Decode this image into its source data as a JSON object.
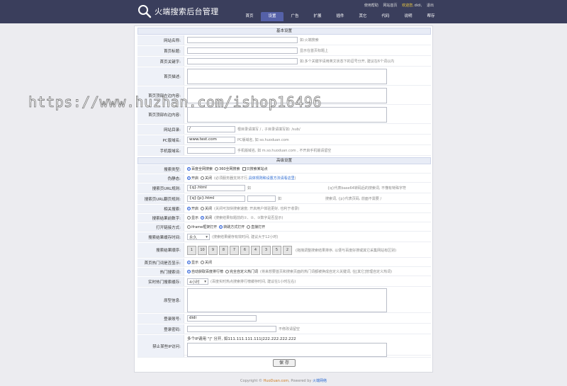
{
  "header": {
    "title": "火端搜索后台管理",
    "toplinks": {
      "help": "使用帮助",
      "home": "网站首页",
      "welcome": "欢迎您,",
      "user": "didi,",
      "logout": "退出"
    },
    "nav": [
      "首页",
      "设置",
      "广告",
      "扩展",
      "插件",
      "其它",
      "代码",
      "说明",
      "帮存"
    ]
  },
  "basic": {
    "title": "基本设置",
    "site_name": {
      "label": "网站名称:",
      "value": "",
      "hint": "如:火端搜索"
    },
    "home_title": {
      "label": "首页标题:",
      "value": "",
      "hint": "显示在首页标题上"
    },
    "home_keywords": {
      "label": "首页关键字:",
      "value": "",
      "hint": "如:多个关键字请用英文状态下的逗号分开, 建议在6个词以内"
    },
    "home_desc": {
      "label": "首页描述:"
    },
    "head_left": {
      "label": "首页顶部左边内容:"
    },
    "head_right": {
      "label": "首页顶部右边内容:"
    },
    "site_dir": {
      "label": "网站目录:",
      "value": "/",
      "hint": "根目录请填写 / , 子目录请填写如: /sub/"
    },
    "pc_domain": {
      "label": "PC版域名:",
      "value": "www.test.com",
      "hint": "PC版域名, 如 so.huoduan.com"
    },
    "m_domain": {
      "label": "手机版域名:",
      "value": "",
      "hint": "手机版域名, 如 m.so.huoduan.com , 不开启手机版请留空"
    }
  },
  "advanced": {
    "title": "高级设置",
    "search_type": {
      "label": "搜索类型:",
      "opt1": "百度全网搜索",
      "opt2": "360全网搜索",
      "opt3": "只搜索某站点"
    },
    "pseudo_static": {
      "label": "伪静态:",
      "on": "开启",
      "off": "关闭",
      "hint": "(必须服务器支持才行,",
      "link": "具体规则和设置方法请看这里",
      "tail": ")"
    },
    "search_url": {
      "label": "搜索页URL规则:",
      "value": "{q}.html",
      "mid": "如",
      "hint": "{q}代表base64转码后的搜索词, 不懂有特殊字符"
    },
    "search_url_page": {
      "label": "搜索页URL翻页规则:",
      "value": "{q}{p}.html",
      "mid": "如",
      "hint": "搜索词, {p}代表页码, 前面不需要 /"
    },
    "related": {
      "label": "相关搜索:",
      "on": "开启",
      "off": "关闭",
      "hint": "(关闭可加快搜索速度; 开启用户体验更好, 也利于收录)"
    },
    "result_count": {
      "label": "搜索结果前数字:",
      "on": "显示",
      "off": "关闭",
      "hint": "(搜索结果标题前的①、②、③数字是否显示)"
    },
    "open_mode": {
      "label": "打开链接方式:",
      "opt1": "iframe框架打开",
      "opt2": "转跳方式打开",
      "opt3": "直接打开"
    },
    "cache_time": {
      "label": "搜索结果缓存时间:",
      "value": "永久",
      "hint": "(搜索结果缓存有效时间, 建议大于12小时)"
    },
    "sort": {
      "label": "搜索结果顺序:",
      "items": [
        "1",
        "10",
        "9",
        "8",
        "7",
        "6",
        "4",
        "3",
        "5",
        "2"
      ],
      "hint": "(拖拽调整搜索结果排序, 以便与百度好搜或其它采集网站有区别)"
    },
    "hot_show": {
      "label": "首页热门词是否显示:",
      "on": "显示",
      "off": "关闭"
    },
    "hot_words": {
      "label": "热门搜索词:",
      "opt1": "自动获取百度排行榜",
      "opt2": "完全自定义热门词",
      "hint": "(将来想要首页和搜索页面的热门词都被换成自定义关键词, 在[其它]管理自定义热词)"
    },
    "realtime_cache": {
      "label": "实时热门搜索缓存:",
      "value": "4小时",
      "hint": "(百度实时热点搜索排行榜缓存时间, 建议在1小时左右)"
    },
    "stats": {
      "label": "原型信息:"
    },
    "login_user": {
      "label": "登录账号:",
      "value": "didi"
    },
    "login_pass": {
      "label": "登录密码:",
      "value": "",
      "hint": "不修改请留空"
    },
    "ban_ip": {
      "label": "禁止某些IP访问:",
      "hint": "多个IP请用 \"|\" 分开, 如111.111.111.111|222.222.222.222"
    }
  },
  "save_label": "保 存",
  "watermark": "https://www.huzhan.com/ishop16496",
  "footer": {
    "prefix": "Copyright ©",
    "site": "HuoDuan.com",
    "mid": ", Powered by",
    "brand": "火端网络"
  }
}
